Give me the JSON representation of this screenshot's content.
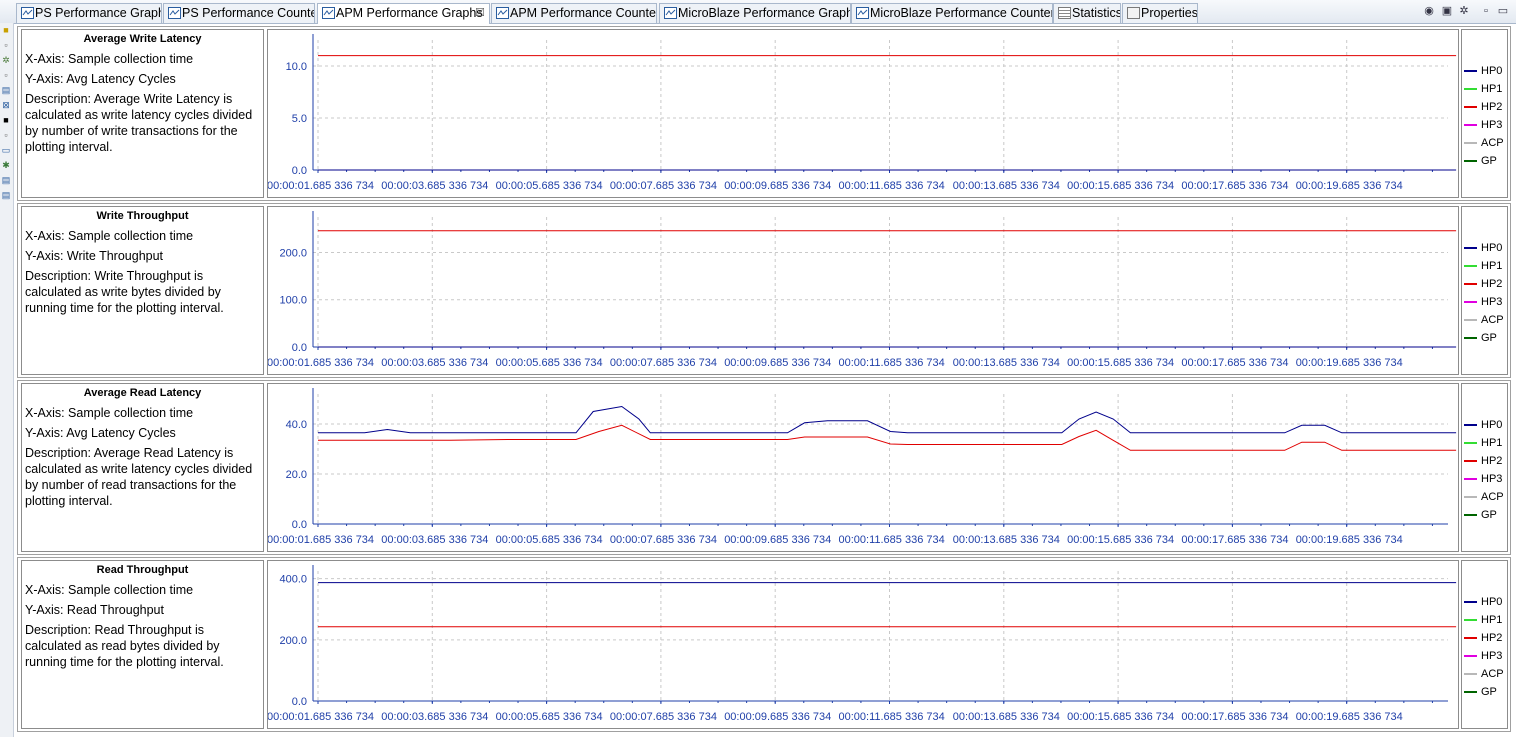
{
  "tabs": [
    {
      "label": "PS Performance Graphs",
      "icon": "graph-icon"
    },
    {
      "label": "PS Performance Counters",
      "icon": "graph-icon"
    },
    {
      "label": "APM Performance Graphs",
      "icon": "graph-icon",
      "active": true,
      "close": "☒"
    },
    {
      "label": "APM Performance Counters",
      "icon": "graph-icon"
    },
    {
      "label": "MicroBlaze Performance Graphs",
      "icon": "graph-icon"
    },
    {
      "label": "MicroBlaze Performance Counters",
      "icon": "graph-icon"
    },
    {
      "label": "Statistics",
      "icon": "statistics-icon"
    },
    {
      "label": "Properties",
      "icon": "properties-icon"
    }
  ],
  "toolbar_icons": [
    "view-icon",
    "export-icon",
    "settings-icon",
    "minimize-icon",
    "maximize-icon"
  ],
  "legend": [
    {
      "name": "HP0",
      "color": "#00008b"
    },
    {
      "name": "HP1",
      "color": "#33dd33"
    },
    {
      "name": "HP2",
      "color": "#e00000"
    },
    {
      "name": "HP3",
      "color": "#e000e0"
    },
    {
      "name": "ACP",
      "color": "#b8b8b8"
    },
    {
      "name": "GP",
      "color": "#006400"
    }
  ],
  "x_ticks": [
    "00:00:01.685 336 734",
    "00:00:03.685 336 734",
    "00:00:05.685 336 734",
    "00:00:07.685 336 734",
    "00:00:09.685 336 734",
    "00:00:11.685 336 734",
    "00:00:13.685 336 734",
    "00:00:15.685 336 734",
    "00:00:17.685 336 734",
    "00:00:19.685 336 734"
  ],
  "panels": [
    {
      "title": "Average Write Latency",
      "xaxis": "X-Axis: Sample collection time",
      "yaxis": "Y-Axis: Avg Latency Cycles",
      "description": "Description: Average Write Latency is calculated as write latency cycles divided by number of write transactions for the plotting interval."
    },
    {
      "title": "Write Throughput",
      "xaxis": "X-Axis: Sample collection time",
      "yaxis": "Y-Axis: Write Throughput",
      "description": "Description: Write Throughput is calculated as write bytes divided by running time for the plotting interval."
    },
    {
      "title": "Average Read Latency",
      "xaxis": "X-Axis: Sample collection time",
      "yaxis": "Y-Axis: Avg Latency Cycles",
      "description": "Description: Average Read Latency is calculated as write latency cycles divided by number of read transactions for the plotting interval."
    },
    {
      "title": "Read Throughput",
      "xaxis": "X-Axis: Sample collection time",
      "yaxis": "Y-Axis: Read Throughput",
      "description": "Description: Read Throughput is calculated as read bytes divided by running time for the plotting interval."
    }
  ],
  "chart_data": [
    {
      "type": "line",
      "title": "Average Write Latency",
      "y_ticks": [
        "0.0",
        "5.0",
        "10.0"
      ],
      "ylim": [
        0,
        12.5
      ],
      "xlim": [
        1.685,
        21.685
      ],
      "grid": true,
      "legend_position": "right",
      "series": [
        {
          "name": "HP0",
          "points": [
            [
              1.685,
              0
            ],
            [
              21.6,
              0
            ]
          ]
        },
        {
          "name": "HP2",
          "points": [
            [
              1.685,
              11
            ],
            [
              21.6,
              11
            ]
          ]
        }
      ]
    },
    {
      "type": "line",
      "title": "Write Throughput",
      "y_ticks": [
        "0.0",
        "100.0",
        "200.0"
      ],
      "ylim": [
        0,
        275
      ],
      "xlim": [
        1.685,
        21.685
      ],
      "grid": true,
      "legend_position": "right",
      "series": [
        {
          "name": "HP0",
          "points": [
            [
              1.685,
              0
            ],
            [
              21.6,
              0
            ]
          ]
        },
        {
          "name": "HP2",
          "points": [
            [
              1.685,
              246
            ],
            [
              21.6,
              246
            ]
          ]
        }
      ]
    },
    {
      "type": "line",
      "title": "Average Read Latency",
      "y_ticks": [
        "0.0",
        "20.0",
        "40.0"
      ],
      "ylim": [
        0,
        52
      ],
      "xlim": [
        1.685,
        21.685
      ],
      "grid": true,
      "legend_position": "right",
      "series": [
        {
          "name": "HP0",
          "points": [
            [
              1.685,
              36.5
            ],
            [
              2.5,
              36.5
            ],
            [
              2.9,
              37.8
            ],
            [
              3.3,
              36.5
            ],
            [
              6.2,
              36.5
            ],
            [
              6.5,
              45
            ],
            [
              7.0,
              47
            ],
            [
              7.3,
              42
            ],
            [
              7.5,
              36.5
            ],
            [
              9.9,
              36.5
            ],
            [
              10.2,
              40.5
            ],
            [
              10.6,
              41.3
            ],
            [
              11.3,
              41.3
            ],
            [
              11.7,
              37
            ],
            [
              12.0,
              36.5
            ],
            [
              14.7,
              36.5
            ],
            [
              15.0,
              42
            ],
            [
              15.3,
              44.8
            ],
            [
              15.6,
              42
            ],
            [
              15.9,
              36.5
            ],
            [
              18.6,
              36.5
            ],
            [
              18.9,
              39.5
            ],
            [
              19.3,
              39.5
            ],
            [
              19.6,
              36.5
            ],
            [
              21.6,
              36.5
            ]
          ]
        },
        {
          "name": "HP2",
          "points": [
            [
              1.685,
              33.5
            ],
            [
              4.0,
              33.5
            ],
            [
              5.0,
              33.8
            ],
            [
              6.2,
              33.8
            ],
            [
              6.6,
              37
            ],
            [
              7.0,
              39.5
            ],
            [
              7.5,
              33.8
            ],
            [
              9.9,
              33.8
            ],
            [
              10.2,
              34.8
            ],
            [
              11.3,
              34.8
            ],
            [
              11.7,
              32
            ],
            [
              12.0,
              31.8
            ],
            [
              14.7,
              31.8
            ],
            [
              15.0,
              35
            ],
            [
              15.3,
              37.5
            ],
            [
              15.6,
              33.5
            ],
            [
              15.9,
              29.5
            ],
            [
              18.6,
              29.5
            ],
            [
              18.9,
              32.7
            ],
            [
              19.3,
              32.7
            ],
            [
              19.6,
              29.5
            ],
            [
              21.6,
              29.5
            ]
          ]
        }
      ]
    },
    {
      "type": "line",
      "title": "Read Throughput",
      "y_ticks": [
        "0.0",
        "200.0",
        "400.0"
      ],
      "ylim": [
        0,
        425
      ],
      "xlim": [
        1.685,
        21.685
      ],
      "grid": true,
      "legend_position": "right",
      "series": [
        {
          "name": "HP0",
          "points": [
            [
              1.685,
              387
            ],
            [
              21.6,
              387
            ]
          ]
        },
        {
          "name": "HP2",
          "points": [
            [
              1.685,
              243
            ],
            [
              21.6,
              243
            ]
          ]
        }
      ]
    }
  ]
}
